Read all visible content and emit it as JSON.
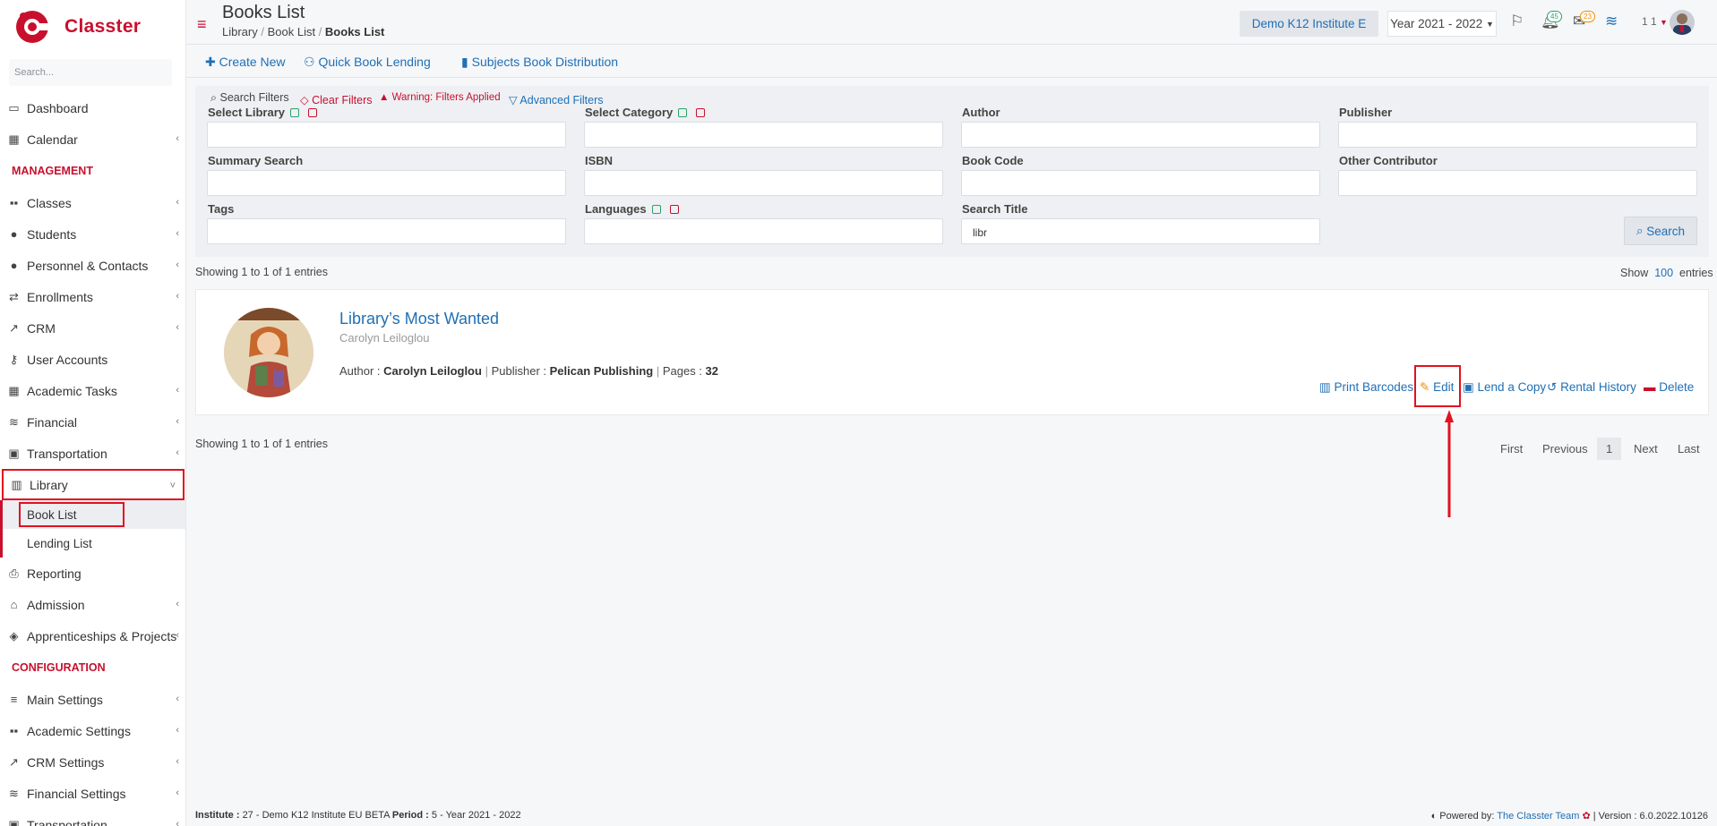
{
  "app": {
    "name": "Classter"
  },
  "sidebar": {
    "search_placeholder": "Search...",
    "items": [
      {
        "label": "Dashboard",
        "icon": "laptop-icon"
      },
      {
        "label": "Calendar",
        "icon": "calendar-icon"
      },
      {
        "label": "MANAGEMENT",
        "heading": true
      },
      {
        "label": "Classes",
        "icon": "classes-icon"
      },
      {
        "label": "Students",
        "icon": "users-icon"
      },
      {
        "label": "Personnel & Contacts",
        "icon": "user-tie-icon"
      },
      {
        "label": "Enrollments",
        "icon": "exchange-icon"
      },
      {
        "label": "CRM",
        "icon": "chart-icon"
      },
      {
        "label": "User Accounts",
        "icon": "key-icon"
      },
      {
        "label": "Academic Tasks",
        "icon": "tasks-icon"
      },
      {
        "label": "Financial",
        "icon": "coins-icon"
      },
      {
        "label": "Transportation",
        "icon": "bus-icon"
      },
      {
        "label": "Library",
        "icon": "books-icon"
      },
      {
        "label": "Book List"
      },
      {
        "label": "Lending List"
      },
      {
        "label": "Reporting",
        "icon": "print-icon"
      },
      {
        "label": "Admission",
        "icon": "bank-icon"
      },
      {
        "label": "Apprenticeships & Projects",
        "icon": "cube-icon"
      },
      {
        "label": "CONFIGURATION",
        "heading": true
      },
      {
        "label": "Main Settings",
        "icon": "sliders-icon"
      },
      {
        "label": "Academic Settings",
        "icon": "classes-icon"
      },
      {
        "label": "CRM Settings",
        "icon": "chart-icon"
      },
      {
        "label": "Financial Settings",
        "icon": "coins-icon"
      },
      {
        "label": "Transportation",
        "icon": "bus-icon"
      }
    ]
  },
  "header": {
    "title": "Books List",
    "breadcrumb": [
      "Library",
      "Book List",
      "Books List"
    ],
    "institute": "Demo K12 Institute E",
    "year": "Year 2021 - 2022",
    "notifications_count": "45",
    "messages_count": "23",
    "user_short": "1 1"
  },
  "actions": {
    "create": "Create New",
    "quick_lending": "Quick Book Lending",
    "subjects": "Subjects Book Distribution"
  },
  "filters": {
    "search_filters": "Search Filters",
    "clear_filters": "Clear Filters",
    "warning": "Warning: Filters Applied",
    "advanced": "Advanced Filters",
    "library": "Select Library",
    "category": "Select Category",
    "author": "Author",
    "publisher": "Publisher",
    "summary": "Summary Search",
    "isbn": "ISBN",
    "book_code": "Book Code",
    "other_contributor": "Other Contributor",
    "tags": "Tags",
    "languages": "Languages",
    "search_title": "Search Title",
    "search_title_value": "libr",
    "search_button": "Search"
  },
  "list": {
    "showing": "Showing 1 to 1 of 1 entries",
    "show": "Show",
    "page_size": "100",
    "entries": "entries"
  },
  "book": {
    "title": "Library’s Most Wanted",
    "author": "Carolyn Leiloglou",
    "author_label": "Author :",
    "publisher_label": "Publisher :",
    "publisher": "Pelican Publishing",
    "pages_label": "Pages :",
    "pages": "32",
    "actions": {
      "print": "Print Barcodes",
      "edit": "Edit",
      "lend": "Lend a Copy",
      "history": "Rental History",
      "delete": "Delete"
    }
  },
  "pagination": {
    "first": "First",
    "previous": "Previous",
    "current": "1",
    "next": "Next",
    "last": "Last"
  },
  "footer": {
    "institute_label": "Institute :",
    "institute_value": "27 - Demo K12 Institute EU BETA",
    "period_label": "Period :",
    "period_value": "5 - Year 2021 - 2022",
    "powered": "Powered by:",
    "team": "The Classter Team",
    "version": "| Version : 6.0.2022.10126"
  },
  "colors": {
    "brand": "#c8102e",
    "link": "#1f6fb5",
    "highlight": "#e0121e"
  }
}
